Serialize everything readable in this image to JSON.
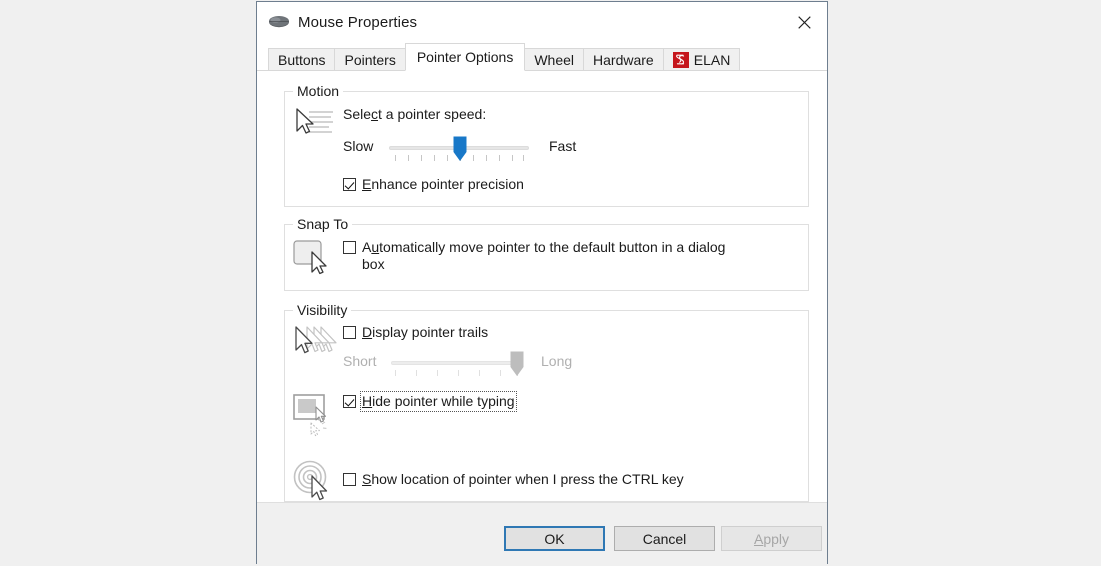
{
  "window": {
    "title": "Mouse Properties",
    "icon": "mouse-icon",
    "close_label": "✕"
  },
  "tabs": [
    {
      "label": "Buttons",
      "active": false
    },
    {
      "label": "Pointers",
      "active": false
    },
    {
      "label": "Pointer Options",
      "active": true
    },
    {
      "label": "Wheel",
      "active": false
    },
    {
      "label": "Hardware",
      "active": false
    },
    {
      "label": "ELAN",
      "active": false,
      "icon": "elan-logo-icon"
    }
  ],
  "motion": {
    "legend": "Motion",
    "icon": "pointer-speed-icon",
    "speed_label_pre": "Sele",
    "speed_label_accel": "c",
    "speed_label_post": "t a pointer speed:",
    "slow_label": "Slow",
    "fast_label": "Fast",
    "slider_value": 6,
    "slider_min": 1,
    "slider_max": 11,
    "enhance": {
      "accel": "E",
      "rest": "nhance pointer precision",
      "checked": true
    }
  },
  "snapto": {
    "legend": "Snap To",
    "icon": "snap-to-button-icon",
    "auto_move": {
      "pre": "A",
      "accel": "u",
      "rest": "tomatically move pointer to the default button in a dialog box",
      "checked": false
    }
  },
  "visibility": {
    "legend": "Visibility",
    "trails": {
      "icon": "pointer-trails-icon",
      "accel": "D",
      "rest": "isplay pointer trails",
      "checked": false,
      "short_label": "Short",
      "long_label": "Long",
      "slider_value": 6,
      "slider_min": 1,
      "slider_max": 7,
      "disabled": true
    },
    "hide_typing": {
      "icon": "hide-pointer-typing-icon",
      "accel": "H",
      "rest": "ide pointer while typing",
      "checked": true,
      "focused": true
    },
    "show_location": {
      "icon": "ctrl-locate-pointer-icon",
      "accel": "S",
      "rest": "how location of pointer when I press the CTRL key",
      "checked": false
    }
  },
  "footer": {
    "ok_label": "OK",
    "cancel_label": "Cancel",
    "apply_accel": "A",
    "apply_rest": "pply",
    "apply_disabled": true
  },
  "colors": {
    "accent": "#2f78b4",
    "slider_thumb": "#0078d4",
    "elan_red": "#c5161c",
    "desktop_bg": "#f0f0f0",
    "dialog_bg": "#ffffff"
  }
}
